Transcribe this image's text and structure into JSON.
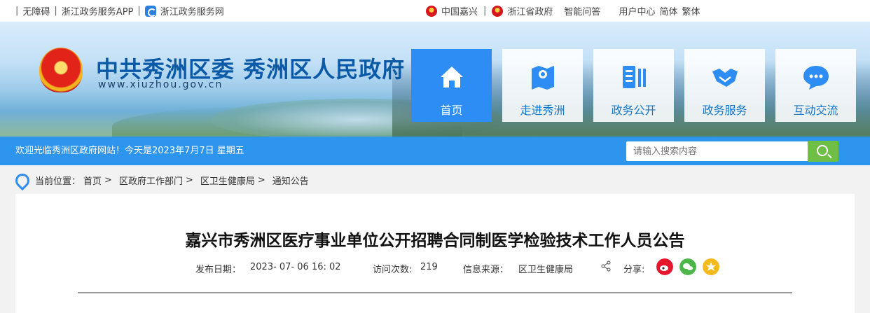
{
  "topbar": {
    "left": [
      "无障碍",
      "浙江政务服务APP",
      "浙江政务服务网"
    ],
    "right": [
      "中国嘉兴",
      "浙江省政府",
      "智能问答",
      "用户中心",
      "简体",
      "繁体"
    ]
  },
  "header": {
    "title": "中共秀洲区委 秀洲区人民政府",
    "url": "www.xiuzhou.gov.cn"
  },
  "nav": [
    {
      "label": "首页",
      "icon": "home-icon",
      "active": true
    },
    {
      "label": "走进秀洲",
      "icon": "map-icon"
    },
    {
      "label": "政务公开",
      "icon": "document-icon"
    },
    {
      "label": "政务服务",
      "icon": "handshake-icon"
    },
    {
      "label": "互动交流",
      "icon": "chat-icon"
    }
  ],
  "welcome": "欢迎光临秀洲区政府网站！今天是2023年7月7日 星期五",
  "search": {
    "placeholder": "请输入搜索内容"
  },
  "breadcrumb": {
    "label": "当前位置：",
    "items": [
      "首页",
      "区政府工作部门",
      "区卫生健康局",
      "通知公告"
    ],
    "separator": ">"
  },
  "article": {
    "title": "嘉兴市秀洲区医疗事业单位公开招聘合同制医学检验技术工作人员公告",
    "date_label": "发布日期：",
    "date": "2023- 07- 06 16: 02",
    "visits_label": "访问次数:",
    "visits": "219",
    "source_label": "信息来源：",
    "source": "区卫生健康局",
    "share_label": "分享:"
  },
  "colors": {
    "accent": "#2d8df5",
    "bar": "#2d95ee",
    "search_btn": "#6fbe46",
    "title": "#0b5aa8"
  }
}
